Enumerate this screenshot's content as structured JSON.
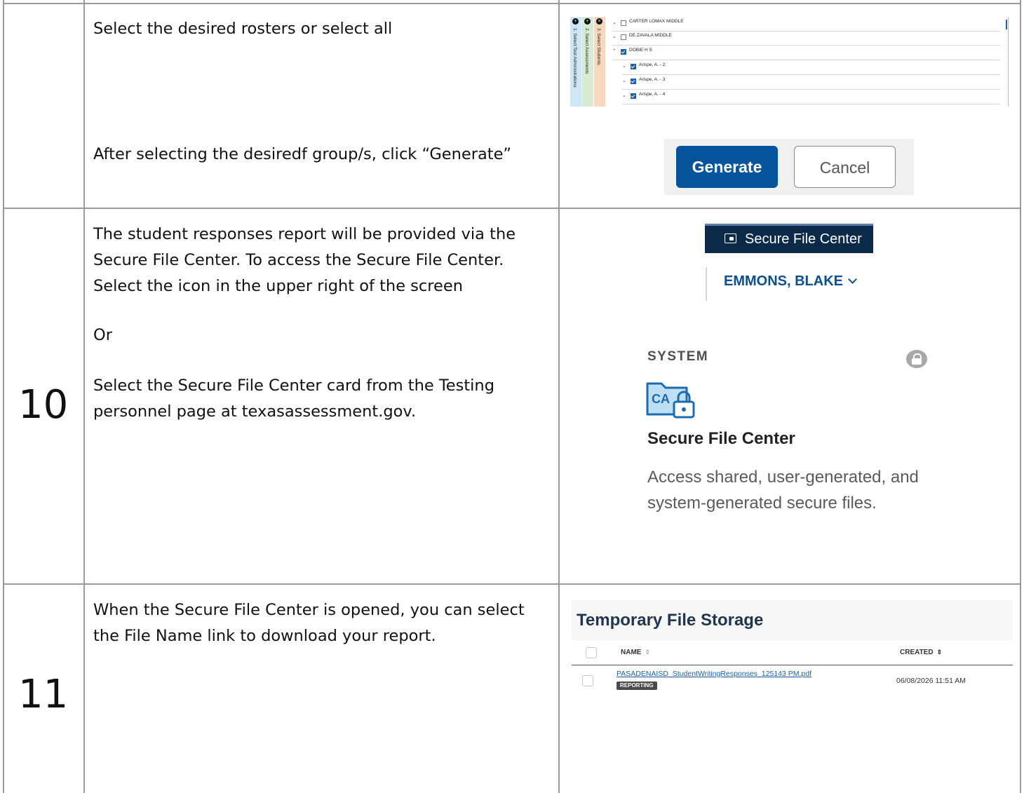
{
  "rows": {
    "row9": {
      "instruction_1": "Select the desired rosters or select all",
      "instruction_2": "After selecting the desiredf group/s, click “Generate”"
    },
    "row10": {
      "number": "10",
      "text_1a": "The student responses report will be provided via the",
      "text_1b": "Secure File Center. To access the Secure File Center.",
      "text_1c": "Select the icon in the upper right of the screen",
      "or": "Or",
      "text_2a": "Select the Secure File Center card from the Testing",
      "text_2b": "personnel page at texasassessment.gov."
    },
    "row11": {
      "number": "11",
      "text_a": "When the Secure File Center is opened, you can select",
      "text_b": "the File Name link to download your report."
    }
  },
  "roster_screen": {
    "steps": [
      {
        "label": "1. Select Test Administrations",
        "color": "#cde7f7",
        "icon": "plus-circle-icon"
      },
      {
        "label": "2. Select Assessments",
        "color": "#d6ecd2",
        "icon": "plus-circle-icon"
      },
      {
        "label": "3. Select Students",
        "color": "#f9d8bd",
        "icon": "close-circle-icon"
      }
    ],
    "items": [
      {
        "label": "CARTER LOMAX MIDDLE",
        "checked": false,
        "expanded": false,
        "level": 0
      },
      {
        "label": "DE ZAVALA MIDDLE",
        "checked": false,
        "expanded": false,
        "level": 0
      },
      {
        "label": "DOBIE H S",
        "checked": true,
        "expanded": true,
        "level": 0
      },
      {
        "label": "Arispe, A. - 2",
        "checked": true,
        "expanded": false,
        "level": 1
      },
      {
        "label": "Arispe, A. - 3",
        "checked": true,
        "expanded": false,
        "level": 1
      },
      {
        "label": "Arispe, A. - 4",
        "checked": true,
        "expanded": false,
        "level": 1
      }
    ]
  },
  "buttons": {
    "generate": "Generate",
    "cancel": "Cancel"
  },
  "header_screen": {
    "secure_file_center": "Secure File Center",
    "user_name": "EMMONS, BLAKE"
  },
  "card_screen": {
    "system_label": "SYSTEM",
    "title": "Secure File Center",
    "description": "Access shared, user-generated, and system-generated secure files."
  },
  "file_storage": {
    "title": "Temporary File Storage",
    "columns": {
      "name": "NAME",
      "created": "CREATED"
    },
    "files": [
      {
        "name": "PASADENAISD_StudentWritingResponses_125143 PM.pdf",
        "tag": "REPORTING",
        "created": "06/08/2026 11:51 AM"
      }
    ]
  }
}
